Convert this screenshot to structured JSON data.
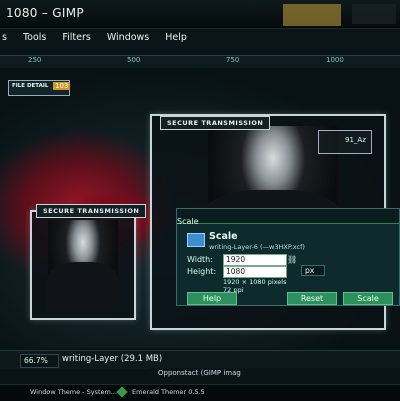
{
  "window": {
    "title": "1080  –  GIMP"
  },
  "menubar": {
    "items": [
      "s",
      "Tools",
      "Filters",
      "Windows",
      "Help"
    ]
  },
  "ruler": {
    "ticks": [
      "250",
      "500",
      "750",
      "1000"
    ]
  },
  "canvas": {
    "panel_left_title": "SECURE TRANSMISSION",
    "panel_center_title": "SECURE TRANSMISSION",
    "panel_top_label": "FILE DETAIL",
    "panel_top_number": "103",
    "right_small_label": "91_Az"
  },
  "scale_dialog": {
    "title": "Scale",
    "subtitle": "writing-Layer-6 (—w3HXP.xcf)",
    "width_label": "Width:",
    "width_value": "1920",
    "height_label": "Height:",
    "height_value": "1080",
    "size_info": "1920 × 1080 pixels",
    "ppi_info": "72 ppi",
    "unit": "px",
    "help_button": "Help",
    "reset_button": "Reset",
    "scale_button": "Scale"
  },
  "statusbar": {
    "zoom": "66.7%",
    "layer_info": "writing-Layer (29.1 MB)"
  },
  "taskbar": {
    "item1": "Window Theme - System...",
    "item2": "Emerald Themer 0.5.5",
    "item3": "Opponstact (GIMP imag"
  },
  "colors": {
    "accent_green": "#2d8f5d",
    "alert_red": "#d1112a",
    "title_yellow": "#c9a43a"
  }
}
